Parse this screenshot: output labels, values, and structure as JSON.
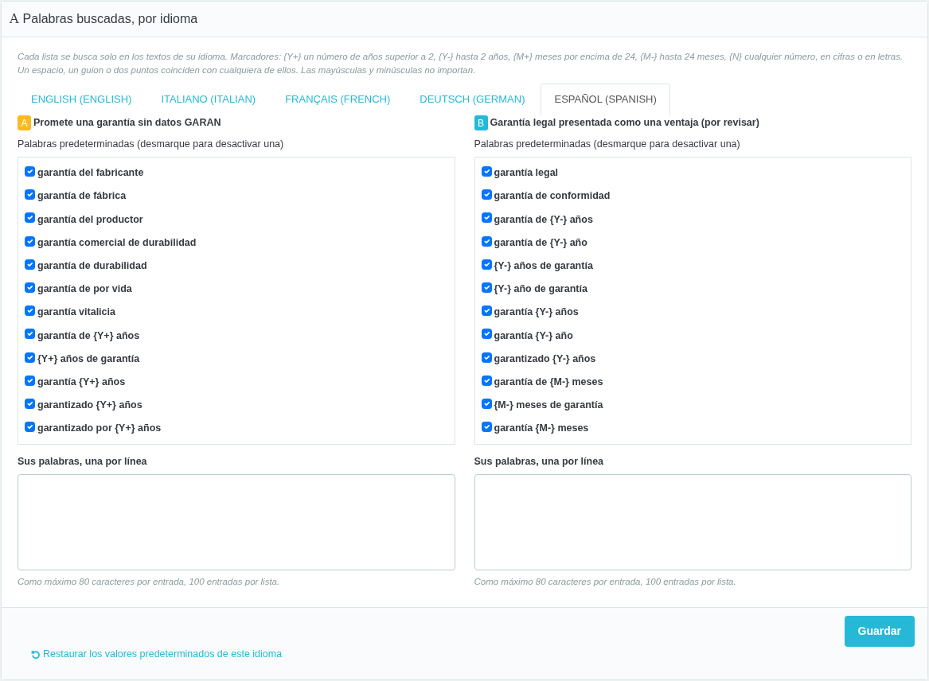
{
  "panel": {
    "icon_glyph": "A",
    "title": "Palabras buscadas, por idioma"
  },
  "description": "Cada lista se busca solo en los textos de su idioma. Marcadores: {Y+} un número de años superior a 2, {Y-} hasta 2 años, {M+} meses por encima de 24, {M-} hasta 24 meses, {N} cualquier número, en cifras o en letras. Un espacio, un guion o dos puntos coinciden con cualquiera de ellos. Las mayúsculas y minúsculas no importan.",
  "tabs": [
    {
      "label": "ENGLISH (ENGLISH)",
      "selected": false
    },
    {
      "label": "ITALIANO (ITALIAN)",
      "selected": false
    },
    {
      "label": "FRANÇAIS (FRENCH)",
      "selected": false
    },
    {
      "label": "DEUTSCH (GERMAN)",
      "selected": false
    },
    {
      "label": "ESPAÑOL (SPANISH)",
      "selected": true
    }
  ],
  "groups": [
    {
      "badge": "A",
      "color": "#fbbb22",
      "title": "Promete una garantía sin datos GARAN",
      "defaults_label": "Palabras predeterminadas (desmarque para desactivar una)",
      "words": [
        {
          "label": "garantía del fabricante",
          "checked": true
        },
        {
          "label": "garantía de fábrica",
          "checked": true
        },
        {
          "label": "garantía del productor",
          "checked": true
        },
        {
          "label": "garantía comercial de durabilidad",
          "checked": true
        },
        {
          "label": "garantía de durabilidad",
          "checked": true
        },
        {
          "label": "garantía de por vida",
          "checked": true
        },
        {
          "label": "garantía vitalicia",
          "checked": true
        },
        {
          "label": "garantía de {Y+} años",
          "checked": true
        },
        {
          "label": "{Y+} años de garantía",
          "checked": true
        },
        {
          "label": "garantía {Y+} años",
          "checked": true
        },
        {
          "label": "garantizado {Y+} años",
          "checked": true
        },
        {
          "label": "garantizado por {Y+} años",
          "checked": true
        }
      ],
      "custom_label": "Sus palabras, una por línea",
      "hint": "Como máximo 80 caracteres por entrada, 100 entradas por lista."
    },
    {
      "badge": "B",
      "color": "#25b9d7",
      "title": "Garantía legal presentada como una ventaja (por revisar)",
      "defaults_label": "Palabras predeterminadas (desmarque para desactivar una)",
      "words": [
        {
          "label": "garantía legal",
          "checked": true
        },
        {
          "label": "garantía de conformidad",
          "checked": true
        },
        {
          "label": "garantía de {Y-} años",
          "checked": true
        },
        {
          "label": "garantía de {Y-} año",
          "checked": true
        },
        {
          "label": "{Y-} años de garantía",
          "checked": true
        },
        {
          "label": "{Y-} año de garantía",
          "checked": true
        },
        {
          "label": "garantía {Y-} años",
          "checked": true
        },
        {
          "label": "garantía {Y-} año",
          "checked": true
        },
        {
          "label": "garantizado {Y-} años",
          "checked": true
        },
        {
          "label": "garantía de {M-} meses",
          "checked": true
        },
        {
          "label": "{M-} meses de garantía",
          "checked": true
        },
        {
          "label": "garantía {M-} meses",
          "checked": true
        }
      ],
      "custom_label": "Sus palabras, una por línea",
      "hint": "Como máximo 80 caracteres por entrada, 100 entradas por lista."
    }
  ],
  "footer": {
    "save_button": "Guardar",
    "restore_link": "Restaurar los valores predeterminados de este idioma"
  }
}
